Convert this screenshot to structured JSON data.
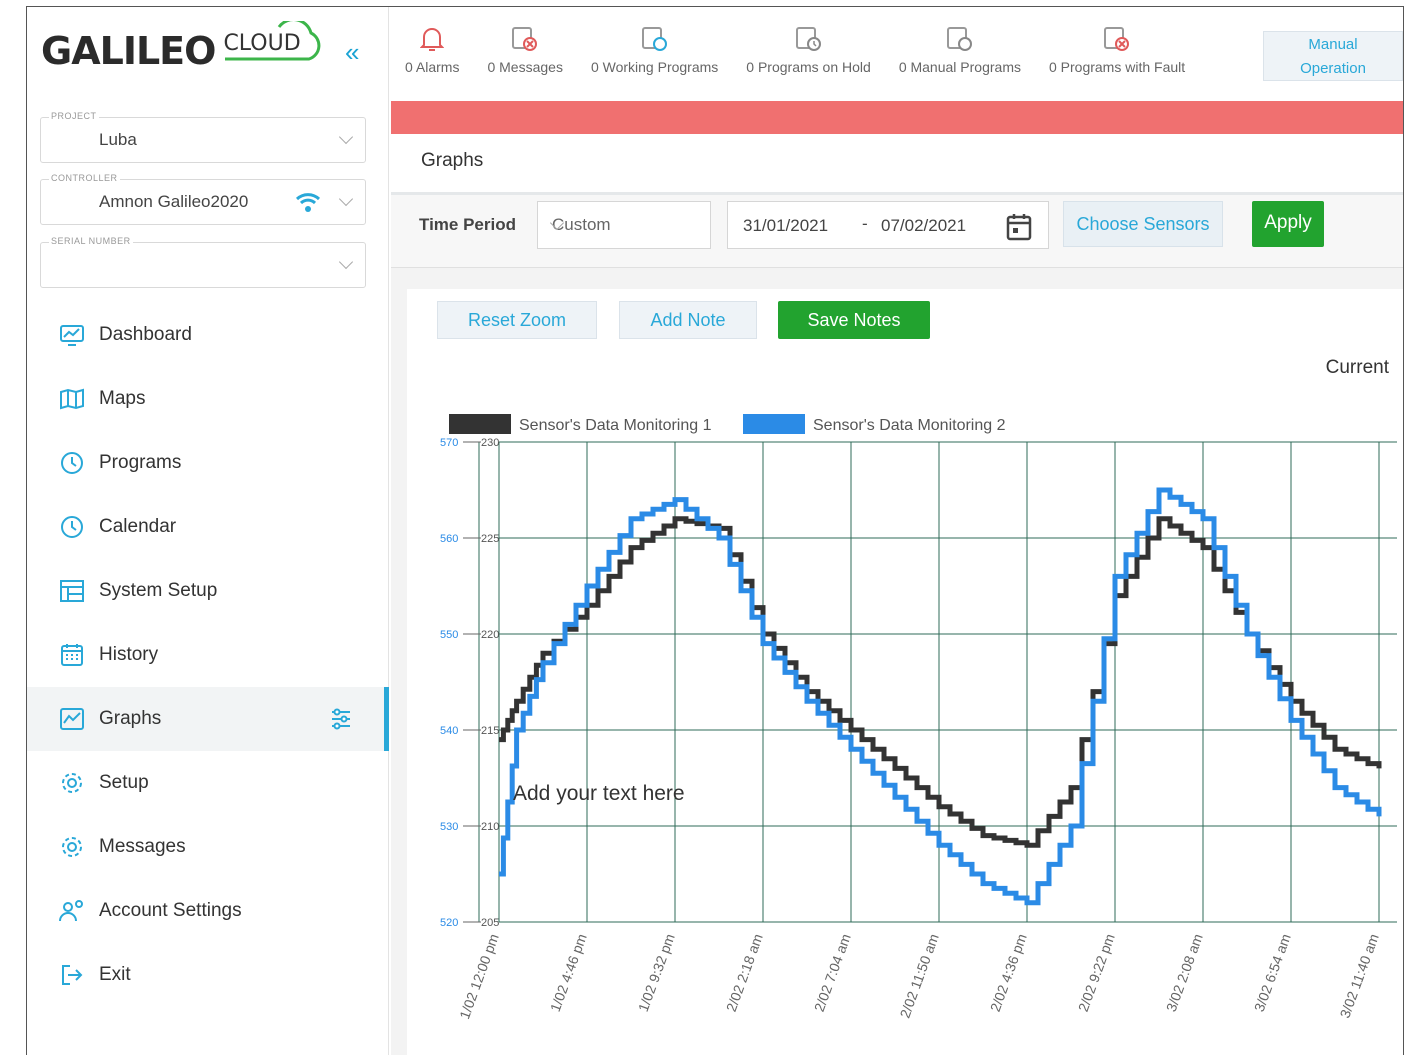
{
  "sidebar": {
    "logo_main": "GALILEO",
    "logo_sub": "CLOUD",
    "collapse_icon": "«",
    "fields": {
      "project": {
        "label": "PROJECT",
        "value": "Luba"
      },
      "controller": {
        "label": "CONTROLLER",
        "value": "Amnon Galileo2020"
      },
      "serial": {
        "label": "SERIAL NUMBER",
        "value": ""
      }
    },
    "nav": [
      {
        "label": "Dashboard",
        "icon": "dashboard-icon"
      },
      {
        "label": "Maps",
        "icon": "map-icon"
      },
      {
        "label": "Programs",
        "icon": "clock-icon"
      },
      {
        "label": "Calendar",
        "icon": "clock-icon"
      },
      {
        "label": "System Setup",
        "icon": "table-icon"
      },
      {
        "label": "History",
        "icon": "calendar-grid-icon"
      },
      {
        "label": "Graphs",
        "icon": "graph-icon",
        "active": true
      },
      {
        "label": "Setup",
        "icon": "gear-icon"
      },
      {
        "label": "Messages",
        "icon": "gear-icon"
      },
      {
        "label": "Account Settings",
        "icon": "users-icon"
      },
      {
        "label": "Exit",
        "icon": "exit-icon"
      }
    ]
  },
  "topbar": {
    "stats": [
      {
        "label": "0 Alarms",
        "icon": "bell-icon"
      },
      {
        "label": "0 Messages",
        "icon": "message-error-icon"
      },
      {
        "label": "0 Working Programs",
        "icon": "program-running-icon"
      },
      {
        "label": "0 Programs on Hold",
        "icon": "program-hold-icon"
      },
      {
        "label": "0 Manual Programs",
        "icon": "program-manual-icon"
      },
      {
        "label": "0 Programs with Fault",
        "icon": "program-fault-icon"
      }
    ],
    "manual_line1": "Manual",
    "manual_line2": "Operation"
  },
  "colors": {
    "accent": "#29a8d8",
    "alert_bar": "#f07070",
    "apply_green": "#22a32f",
    "series1": "#333333",
    "series2": "#2b8be6"
  },
  "page": {
    "title": "Graphs"
  },
  "filters": {
    "time_period_label": "Time Period",
    "period_value": "Custom",
    "date_from": "31/01/2021",
    "date_sep": "-",
    "date_to": "07/02/2021",
    "choose_sensors": "Choose Sensors",
    "apply": "Apply"
  },
  "actions": {
    "reset_zoom": "Reset Zoom",
    "add_note": "Add Note",
    "save_notes": "Save Notes"
  },
  "chart_title": "Current",
  "chart_data": {
    "type": "line",
    "legend": [
      "Sensor's Data Monitoring 1",
      "Sensor's Data Monitoring 2"
    ],
    "y_left_ticks": [
      "570",
      "560",
      "550",
      "540",
      "530",
      "520"
    ],
    "y_right_ticks": [
      "230",
      "225",
      "220",
      "215",
      "210",
      "205"
    ],
    "ylim": [
      205,
      230
    ],
    "x_ticks": [
      "1/02 12:00 pm",
      "1/02 4:46 pm",
      "1/02 9:32 pm",
      "2/02 2:18 am",
      "2/02 7:04 am",
      "2/02 11:50 am",
      "2/02 4:36 pm",
      "2/02 9:22 pm",
      "3/02 2:08 am",
      "3/02 6:54 am",
      "3/02 11:40 am"
    ],
    "annotation": "Add your text here",
    "grid": true,
    "legend_position": "top-left",
    "series": [
      {
        "name": "Sensor's Data Monitoring 1",
        "x": [
          0,
          0.2,
          0.5,
          1,
          1.5,
          2,
          2.5,
          3,
          3.5,
          4,
          4.5,
          5,
          5.5,
          6,
          6.5,
          7,
          7.5,
          8,
          8.5,
          9,
          9.5,
          10
        ],
        "y": [
          214.5,
          216.5,
          219,
          221.5,
          224.5,
          226,
          225.5,
          220,
          217,
          215,
          213,
          211,
          209.5,
          209,
          212,
          222,
          226,
          224.5,
          220,
          216.5,
          214,
          213
        ]
      },
      {
        "name": "Sensor's Data Monitoring 2",
        "x": [
          0,
          0.2,
          0.5,
          1,
          1.5,
          2,
          2.5,
          3,
          3.5,
          4,
          4.5,
          5,
          5.5,
          6,
          6.5,
          7,
          7.5,
          8,
          8.5,
          9,
          9.5,
          10
        ],
        "y": [
          207.5,
          215,
          218.5,
          222.5,
          226,
          227,
          225,
          219.5,
          216.5,
          214,
          211.5,
          209,
          207,
          206,
          210,
          223,
          227.5,
          226,
          220,
          215.5,
          212,
          210.5
        ]
      }
    ]
  }
}
